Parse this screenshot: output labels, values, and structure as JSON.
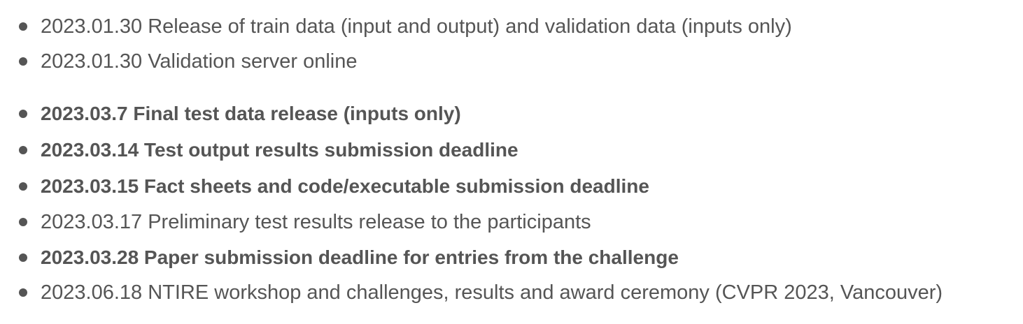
{
  "timeline": {
    "items": [
      {
        "text": "2023.01.30 Release of train data (input and output) and validation data (inputs only)",
        "bold": false
      },
      {
        "text": "2023.01.30 Validation server online",
        "bold": false
      },
      {
        "text": "2023.03.7 Final test data release (inputs only)",
        "bold": true
      },
      {
        "text": "2023.03.14 Test output results submission deadline",
        "bold": true
      },
      {
        "text": "2023.03.15 Fact sheets and code/executable submission deadline",
        "bold": true
      },
      {
        "text": "2023.03.17 Preliminary test results release to the participants",
        "bold": false
      },
      {
        "text": "2023.03.28 Paper submission deadline for entries from the challenge",
        "bold": true
      },
      {
        "text": "2023.06.18 NTIRE workshop and challenges, results and award ceremony (CVPR 2023, Vancouver)",
        "bold": false
      }
    ]
  }
}
